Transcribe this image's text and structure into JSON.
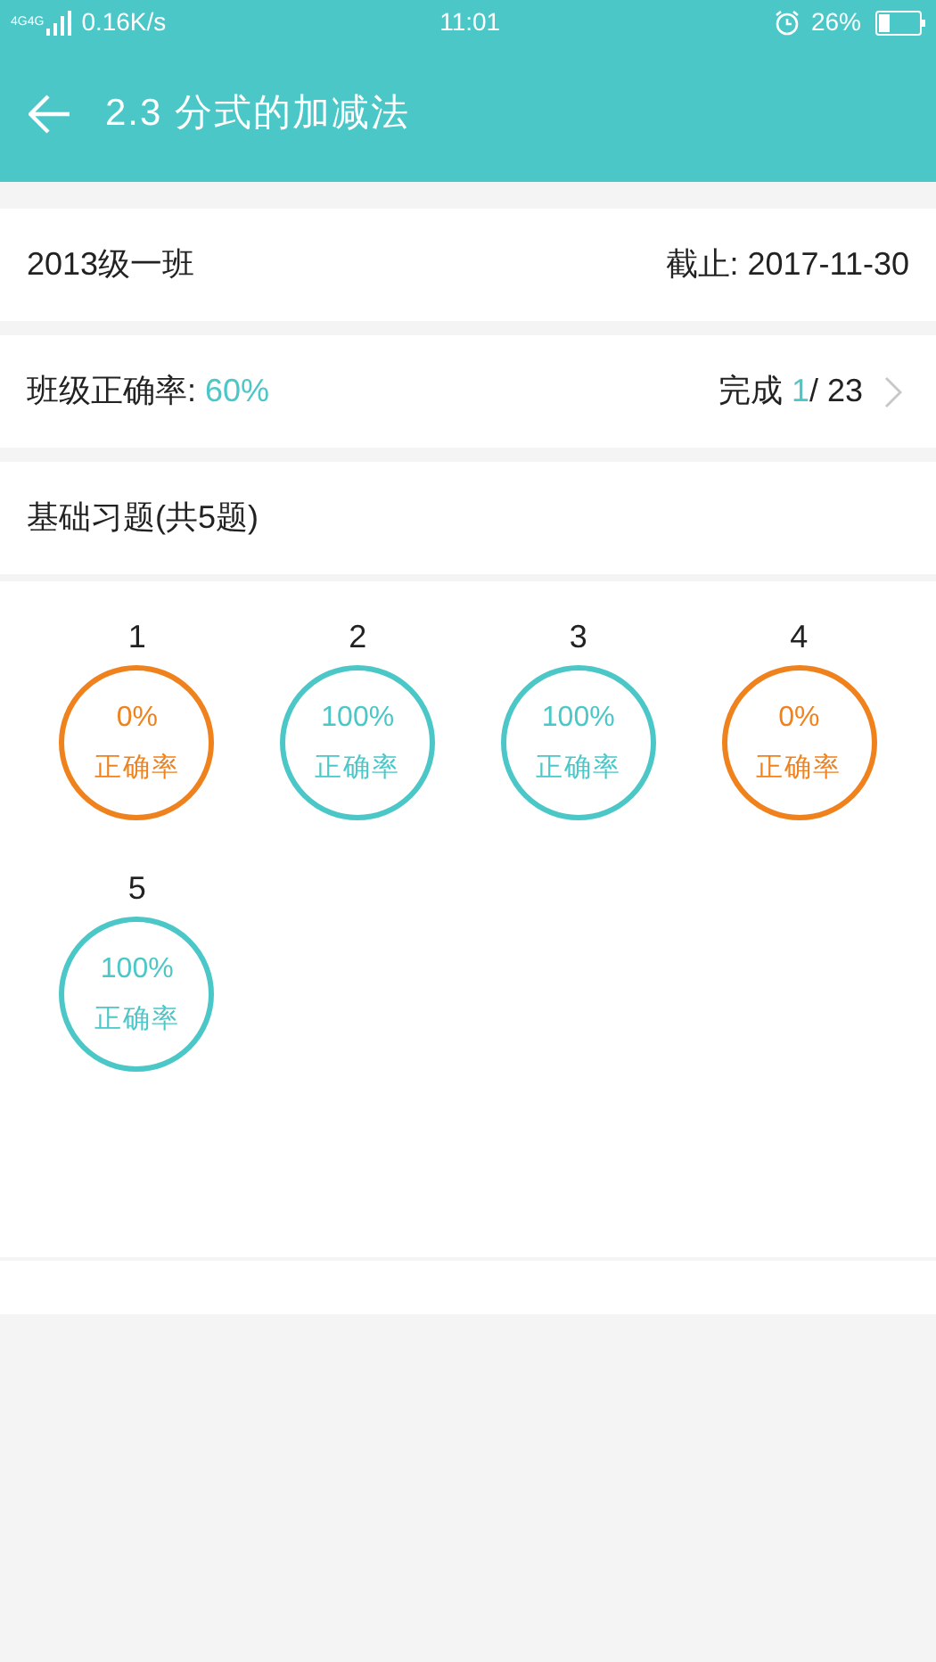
{
  "status_bar": {
    "network": "4G4G",
    "speed": "0.16K/s",
    "time": "11:01",
    "battery": "26%"
  },
  "header": {
    "title": "2.3 分式的加减法"
  },
  "info": {
    "class_name": "2013级一班",
    "deadline": "截止: 2017-11-30"
  },
  "summary": {
    "accuracy_label": "班级正确率: ",
    "accuracy_value": "60%",
    "done_label": "完成 ",
    "done_value": "1",
    "done_total": "/ 23"
  },
  "section": {
    "title": "基础习题(共5题)"
  },
  "questions": [
    {
      "number": "1",
      "rate": "0%",
      "caption": "正确率",
      "color": "#f0821e"
    },
    {
      "number": "2",
      "rate": "100%",
      "caption": "正确率",
      "color": "#4cc7c8"
    },
    {
      "number": "3",
      "rate": "100%",
      "caption": "正确率",
      "color": "#4cc7c8"
    },
    {
      "number": "4",
      "rate": "0%",
      "caption": "正确率",
      "color": "#f0821e"
    },
    {
      "number": "5",
      "rate": "100%",
      "caption": "正确率",
      "color": "#4cc7c8"
    }
  ]
}
